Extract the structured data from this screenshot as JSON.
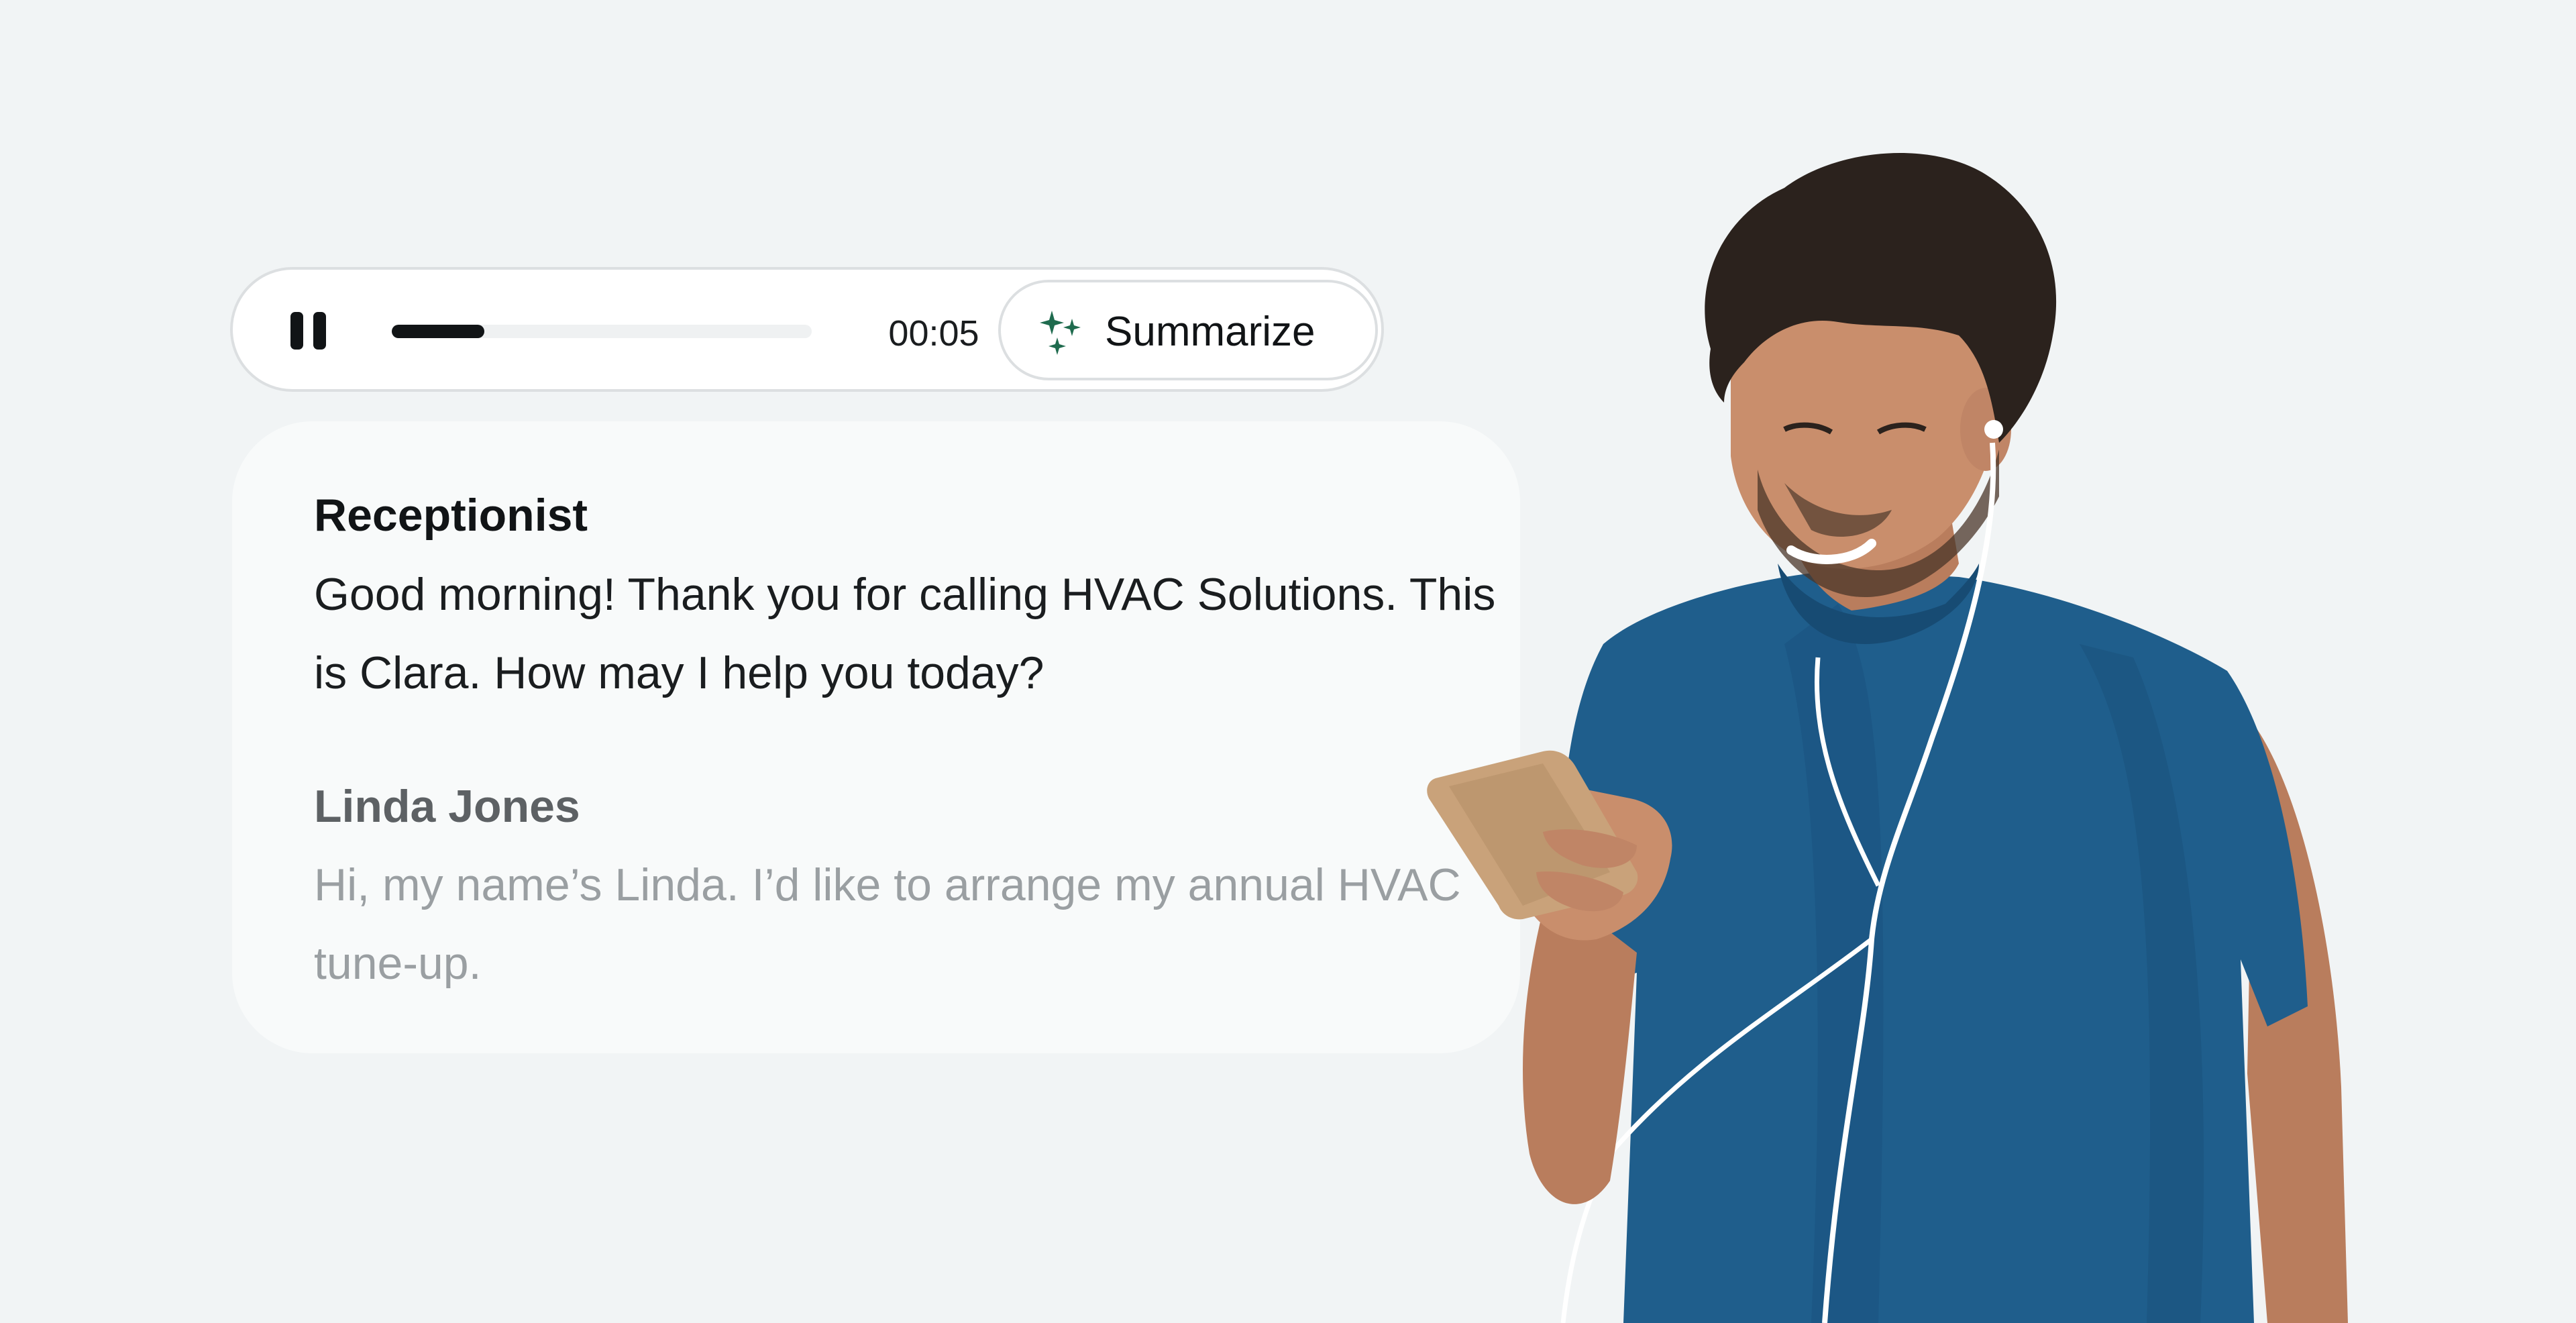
{
  "player": {
    "pause_icon": "pause-icon",
    "progress": 0.22,
    "time": "00:05",
    "summarize_label": "Summarize",
    "summarize_icon": "sparkle-icon",
    "accent_color": "#1f6b4e"
  },
  "transcript": [
    {
      "speaker": "Receptionist",
      "text": "Good morning! Thank you for calling HVAC Solutions. This is Clara. How may I help you today?"
    },
    {
      "speaker": "Linda Jones",
      "text": "Hi, my name’s Linda. I’d like to arrange my annual HVAC tune-up."
    }
  ],
  "colors": {
    "background": "#f1f4f5",
    "shirt": "#1f5e8c",
    "skin": "#c98e6c",
    "hair": "#2b221d"
  }
}
